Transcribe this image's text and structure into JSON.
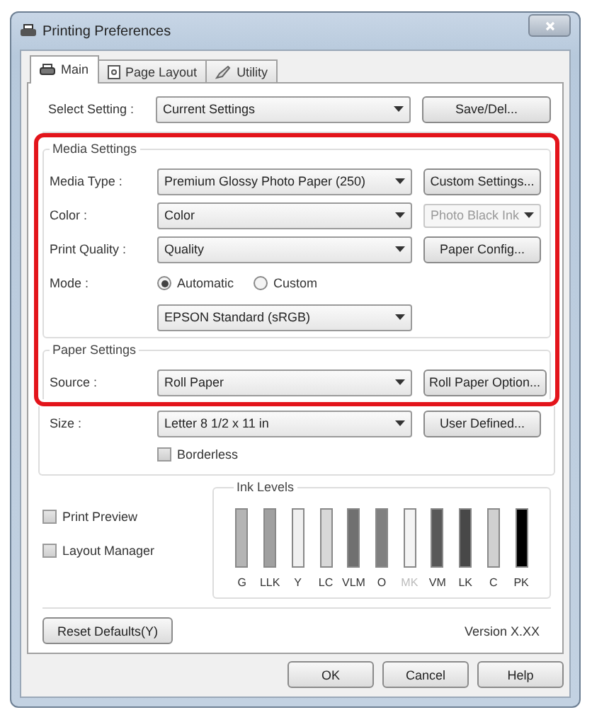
{
  "window": {
    "title": "Printing Preferences"
  },
  "tabs": [
    {
      "label": "Main",
      "selected": true
    },
    {
      "label": "Page Layout",
      "selected": false
    },
    {
      "label": "Utility",
      "selected": false
    }
  ],
  "select_setting": {
    "label": "Select Setting :",
    "value": "Current Settings",
    "button": "Save/Del..."
  },
  "highlight_frame": true,
  "media_settings": {
    "legend": "Media Settings",
    "rows": [
      {
        "label": "Media Type :",
        "value": "Premium Glossy Photo Paper (250)",
        "side": {
          "kind": "button",
          "label": "Custom Settings...",
          "disabled": false
        }
      },
      {
        "label": "Color :",
        "value": "Color",
        "side": {
          "kind": "combo",
          "label": "Photo Black Ink",
          "disabled": true
        }
      },
      {
        "label": "Print Quality :",
        "value": "Quality",
        "side": {
          "kind": "button",
          "label": "Paper Config...",
          "disabled": false
        }
      }
    ],
    "mode": {
      "label": "Mode :",
      "options": [
        {
          "label": "Automatic",
          "selected": true
        },
        {
          "label": "Custom",
          "selected": false
        }
      ],
      "value": "EPSON Standard (sRGB)"
    }
  },
  "paper_settings": {
    "legend": "Paper Settings",
    "rows": [
      {
        "label": "Source :",
        "value": "Roll Paper",
        "side": {
          "kind": "button",
          "label": "Roll Paper Option...",
          "disabled": false
        }
      },
      {
        "label": "Size :",
        "value": "Letter 8 1/2 x 11 in",
        "side": {
          "kind": "button",
          "label": "User Defined...",
          "disabled": false
        }
      }
    ],
    "borderless": {
      "label": "Borderless",
      "checked": false
    }
  },
  "options": [
    {
      "label": "Print Preview",
      "checked": false
    },
    {
      "label": "Layout Manager",
      "checked": false
    }
  ],
  "ink_levels": {
    "legend": "Ink Levels",
    "inks": [
      {
        "label": "G",
        "color": "#b4b4b4",
        "level": 1,
        "disabled": false
      },
      {
        "label": "LLK",
        "color": "#a0a0a0",
        "level": 1,
        "disabled": false
      },
      {
        "label": "Y",
        "color": "#f0f0f0",
        "level": 1,
        "disabled": false
      },
      {
        "label": "LC",
        "color": "#d8d8d8",
        "level": 1,
        "disabled": false
      },
      {
        "label": "VLM",
        "color": "#707070",
        "level": 1,
        "disabled": false
      },
      {
        "label": "O",
        "color": "#808080",
        "level": 1,
        "disabled": false
      },
      {
        "label": "MK",
        "color": "#f4f4f4",
        "level": 1,
        "disabled": true
      },
      {
        "label": "VM",
        "color": "#585858",
        "level": 1,
        "disabled": false
      },
      {
        "label": "LK",
        "color": "#484848",
        "level": 1,
        "disabled": false
      },
      {
        "label": "C",
        "color": "#d0d0d0",
        "level": 1,
        "disabled": false
      },
      {
        "label": "PK",
        "color": "#000000",
        "level": 1,
        "disabled": false
      }
    ]
  },
  "reset_button": "Reset Defaults(Y)",
  "version": "Version X.XX",
  "buttons": [
    "OK",
    "Cancel",
    "Help"
  ]
}
